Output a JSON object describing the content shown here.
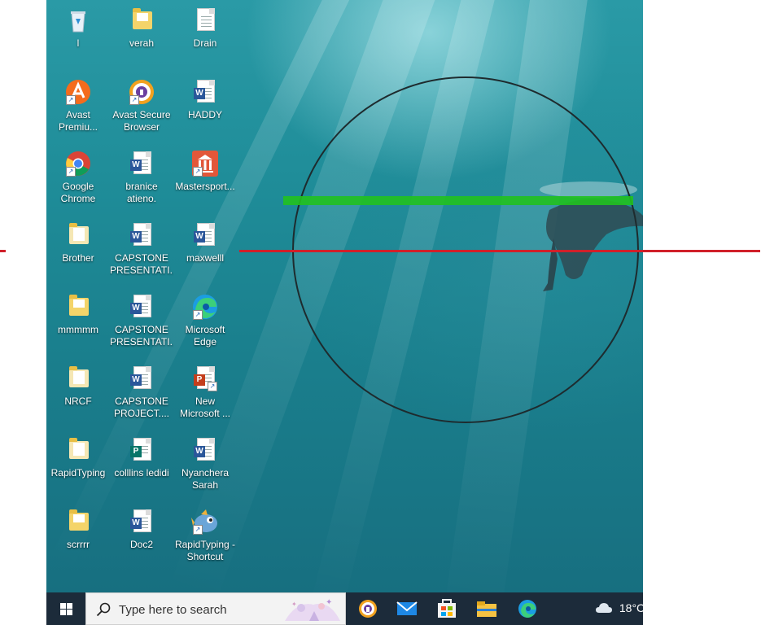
{
  "desktop_icons": [
    {
      "label": "l",
      "type": "recycle-bin"
    },
    {
      "label": "verah",
      "type": "folder"
    },
    {
      "label": "Drain",
      "type": "text-file"
    },
    {
      "label": "Avast\nPremiu...",
      "type": "avast"
    },
    {
      "label": "Avast Secure\nBrowser",
      "type": "avast-browser"
    },
    {
      "label": "HADDY",
      "type": "word"
    },
    {
      "label": "Google\nChrome",
      "type": "chrome"
    },
    {
      "label": "branice\natieno.",
      "type": "word"
    },
    {
      "label": "Mastersport...",
      "type": "mastersport"
    },
    {
      "label": "Brother",
      "type": "folder-doc"
    },
    {
      "label": "CAPSTONE\nPRESENTATI...",
      "type": "word"
    },
    {
      "label": "maxwelll",
      "type": "word"
    },
    {
      "label": "mmmmm",
      "type": "folder"
    },
    {
      "label": "CAPSTONE\nPRESENTATI...",
      "type": "word"
    },
    {
      "label": "Microsoft\nEdge",
      "type": "edge"
    },
    {
      "label": "NRCF",
      "type": "folder-doc"
    },
    {
      "label": "CAPSTONE\nPROJECT....",
      "type": "word"
    },
    {
      "label": "New\nMicrosoft ...",
      "type": "powerpoint"
    },
    {
      "label": "RapidTyping",
      "type": "folder-doc"
    },
    {
      "label": "colllins ledidi",
      "type": "publisher"
    },
    {
      "label": "Nyanchera\nSarah",
      "type": "word"
    },
    {
      "label": "scrrrr",
      "type": "folder"
    },
    {
      "label": "Doc2",
      "type": "word"
    },
    {
      "label": "RapidTyping -\nShortcut",
      "type": "rapidtyping"
    }
  ],
  "taskbar": {
    "search_placeholder": "Type here to search",
    "pinned": [
      "avast-secure-browser-icon",
      "mail-icon",
      "store-icon",
      "file-explorer-icon",
      "edge-icon"
    ],
    "weather_text": "18°C"
  },
  "colors": {
    "taskbar": "#1c2b3a",
    "overlay_green": "#21c11f",
    "overlay_red": "#d0202a",
    "circle": "#1e2b2e"
  }
}
